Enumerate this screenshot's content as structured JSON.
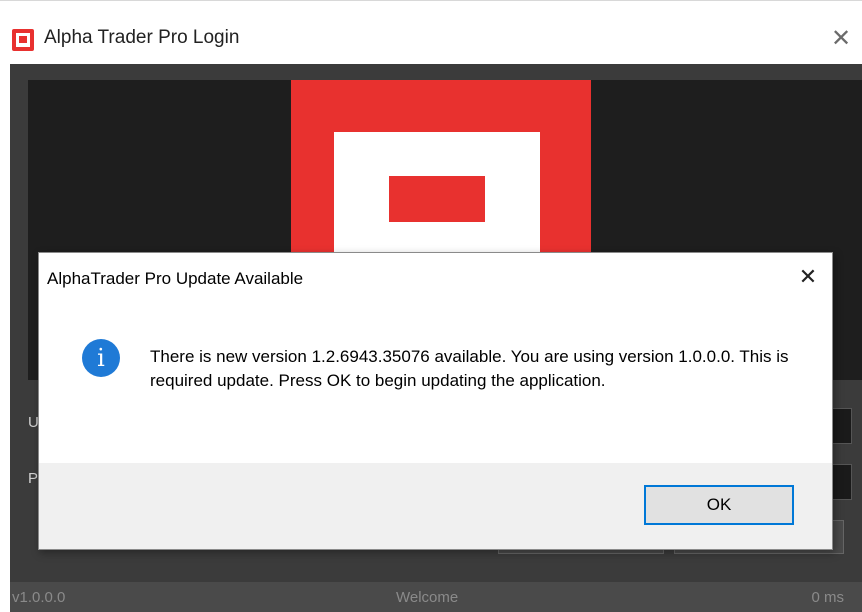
{
  "window": {
    "title": "Alpha Trader Pro Login",
    "close_glyph": "✕"
  },
  "login": {
    "username_label": "U",
    "password_label": "P"
  },
  "statusbar": {
    "version": "v1.0.0.0",
    "message": "Welcome",
    "latency": "0 ms"
  },
  "dialog": {
    "title": "AlphaTrader Pro Update Available",
    "close_glyph": "✕",
    "icon": "info-icon",
    "icon_glyph": "i",
    "message": "There is new version 1.2.6943.35076 available. You are using version 1.0.0.0. This is required update. Press OK to begin updating the application.",
    "ok_label": "OK"
  },
  "colors": {
    "brand_red": "#e8312f",
    "window_dark": "#3b3b3b",
    "banner_bg": "#1e1e1e",
    "info_blue": "#1f7ad6",
    "focus_blue": "#0078d7"
  }
}
